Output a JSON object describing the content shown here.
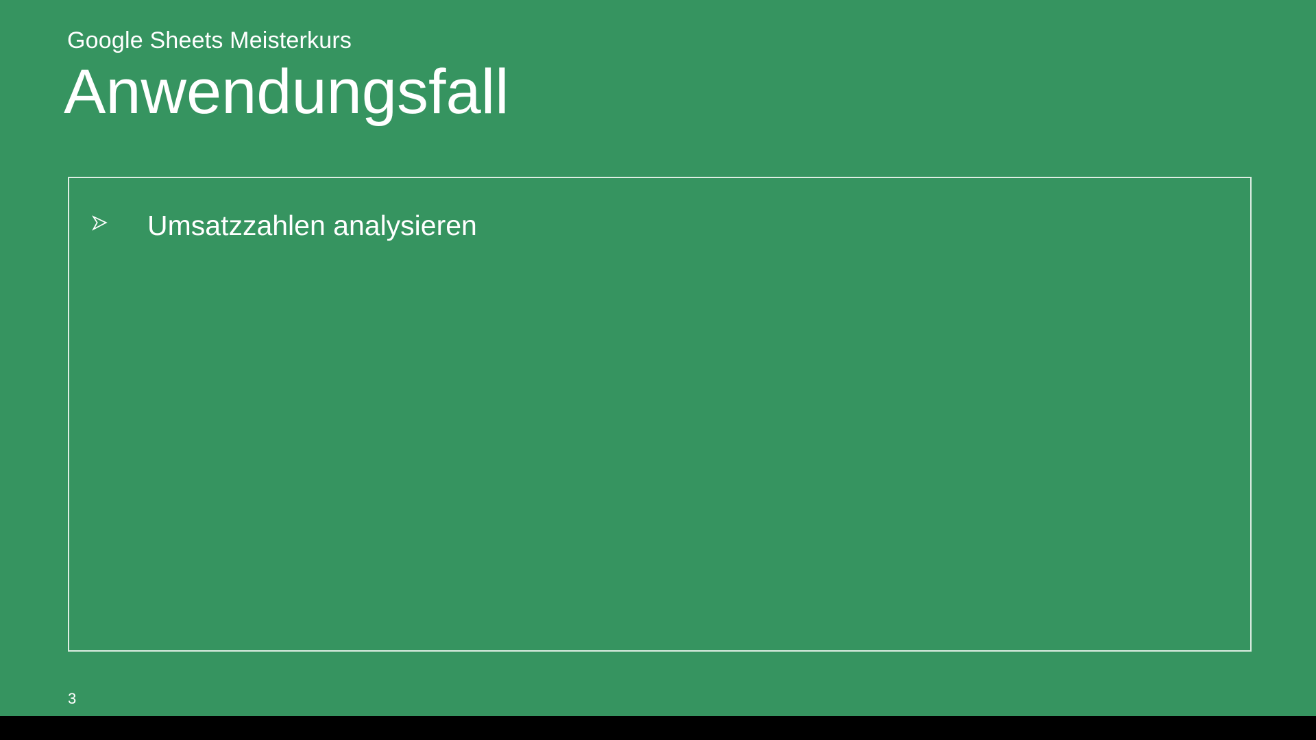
{
  "slide": {
    "subtitle": "Google Sheets Meisterkurs",
    "title": "Anwendungsfall",
    "bullets": [
      {
        "text": "Umsatzzahlen analysieren"
      }
    ],
    "page_number": "3"
  },
  "colors": {
    "background": "#369460",
    "text": "#ffffff",
    "box_border": "#dfeee4"
  }
}
